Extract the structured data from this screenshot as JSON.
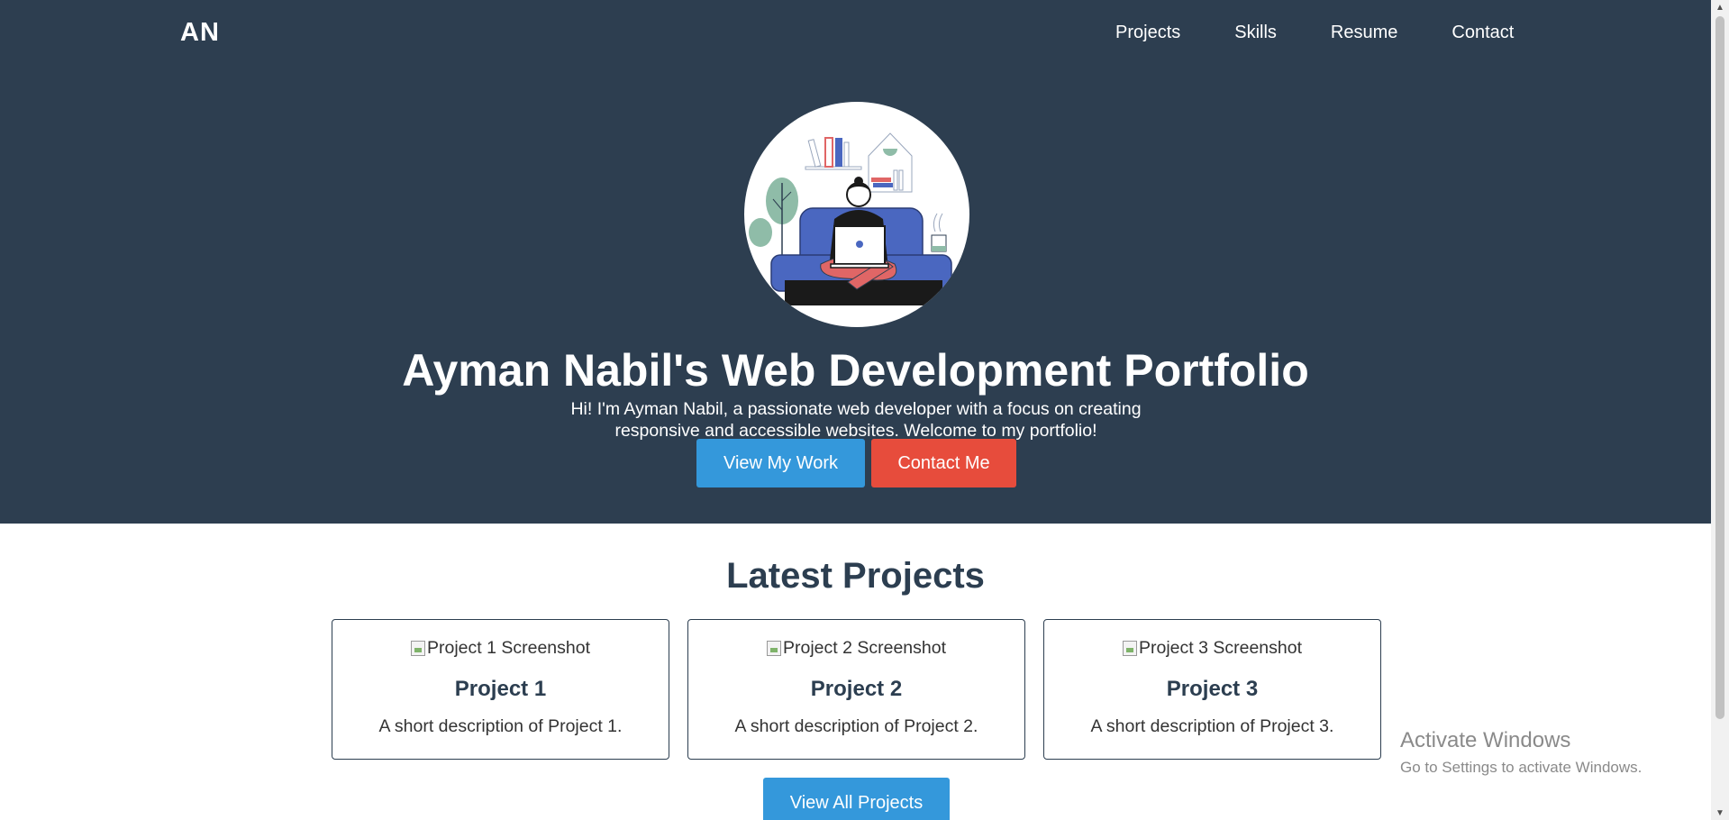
{
  "brand": {
    "logo": "AN"
  },
  "nav": {
    "items": [
      {
        "label": "Projects"
      },
      {
        "label": "Skills"
      },
      {
        "label": "Resume"
      },
      {
        "label": "Contact"
      }
    ]
  },
  "hero": {
    "title": "Ayman Nabil's Web Development Portfolio",
    "intro": "Hi! I'm Ayman Nabil, a passionate web developer with a focus on creating responsive and accessible websites. Welcome to my portfolio!",
    "buttons": {
      "work": "View My Work",
      "contact": "Contact Me"
    },
    "avatar_icon": "person-with-laptop-illustration"
  },
  "projects": {
    "title": "Latest Projects",
    "cards": [
      {
        "img_alt": "Project 1 Screenshot",
        "title": "Project 1",
        "desc": "A short description of Project 1."
      },
      {
        "img_alt": "Project 2 Screenshot",
        "title": "Project 2",
        "desc": "A short description of Project 2."
      },
      {
        "img_alt": "Project 3 Screenshot",
        "title": "Project 3",
        "desc": "A short description of Project 3."
      }
    ],
    "view_all": "View All Projects"
  },
  "watermark": {
    "line1": "Activate Windows",
    "line2": "Go to Settings to activate Windows."
  },
  "colors": {
    "hero_bg": "#2d3e50",
    "primary": "#3498db",
    "danger": "#e74c3c",
    "heading": "#2c3e50"
  }
}
